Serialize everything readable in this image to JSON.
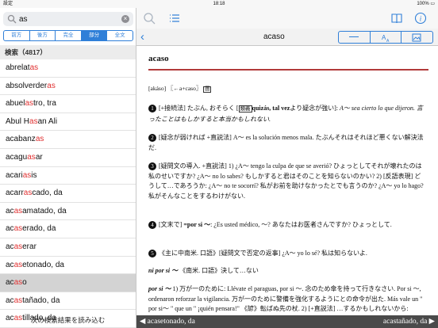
{
  "status": {
    "left": "設定 ",
    "time": "18:18",
    "right": "100% ▭"
  },
  "search": {
    "value": "as",
    "clear": "×"
  },
  "modes": [
    "前方",
    "後方",
    "完全",
    "部分",
    "全文"
  ],
  "active_mode": 3,
  "results_label": "検索（4817）",
  "list": [
    {
      "pre": "abrelat",
      "hl": "as",
      "post": ""
    },
    {
      "pre": "absolverder",
      "hl": "as",
      "post": ""
    },
    {
      "pre": "abuel",
      "hl": "as",
      "post": "tro, tra"
    },
    {
      "pre": "Abul H",
      "hl": "as",
      "post": "an Ali"
    },
    {
      "pre": "acabanz",
      "hl": "as",
      "post": ""
    },
    {
      "pre": "acagu",
      "hl": "as",
      "post": "ar"
    },
    {
      "pre": "acari",
      "hl": "as",
      "post": "is"
    },
    {
      "pre": "acarr",
      "hl": "as",
      "post": "cado, da"
    },
    {
      "pre": "ac",
      "hl": "as",
      "post": "amatado, da"
    },
    {
      "pre": "ac",
      "hl": "as",
      "post": "erado, da"
    },
    {
      "pre": "ac",
      "hl": "as",
      "post": "erar"
    },
    {
      "pre": "ac",
      "hl": "as",
      "post": "etonado, da"
    },
    {
      "pre": "ac",
      "hl": "as",
      "post": "o"
    },
    {
      "pre": "ac",
      "hl": "as",
      "post": "tañado, da"
    },
    {
      "pre": "ac",
      "hl": "as",
      "post": "tillado, da"
    }
  ],
  "selected_index": 12,
  "load_more": "次の検索結果を読み込む",
  "entry": {
    "title": "acaso",
    "headword": "acaso",
    "pronunciation": "[akáso] 〖←a+caso〗",
    "s1_a": "[+接続法] たぶん, おそらく [",
    "s1_box": "類義",
    "s1_b": "quizás, tal vez",
    "s1_c": "より疑念が強い]: ",
    "s1_d": "A～ sea cierto lo que dijeron. 言ったことはもしかすると本当かもしれない.",
    "s2": "[疑念が弱ければ +直説法] A～ es la solución menos mala. たぶんそれはそれほど悪くない解決法だ.",
    "s3": "[疑問文の導入. +直説法] 1) ¿A～ tengo la culpa de que se averió? ひょっとしてそれが壊れたのは私のせいですか? ¿A～ no lo sabes? もしかすると君はそのことを知らないのかい? 2) [反語表現] どうして…であろうか: ¿A～ no te socorrí? 私がお前を助けなかったとでも言うのか? ¿A～ yo lo hago? 私がそんなことをするわけがない.",
    "s4_a": "[文末で] ",
    "s4_b": "=por si ～",
    "s4_c": ": ¿Es usted médico, ～? あなたはお医者さんですか? ひょっとして.",
    "s5": "《主に中南米. 口語》[疑問文で否定の返事] ¿A～ yo lo sé? 私は知らないよ.",
    "phrase1_head": "ni por si ～",
    "phrase1": "《南米. 口語》決して…ない",
    "phrase2_head": "por si ～",
    "phrase2": "1) 万が一のために: Llévate el paraguas, por si ～. 念のため傘を持って行きなさい. Por si ～, ordenaron reforzar la vigilancia. 万が一のために警備を強化するようにとの命令が出た. Más vale un \" por si～ \" que un \" ¡quién pensara!\" 《諺》転ばぬ先の杖. 2) [+直説法] …するかもしれないから: Llévate el paraguas, por si"
  },
  "prev_entry": "◀ acasetonado, da",
  "next_entry": "acastañado, da ▶"
}
